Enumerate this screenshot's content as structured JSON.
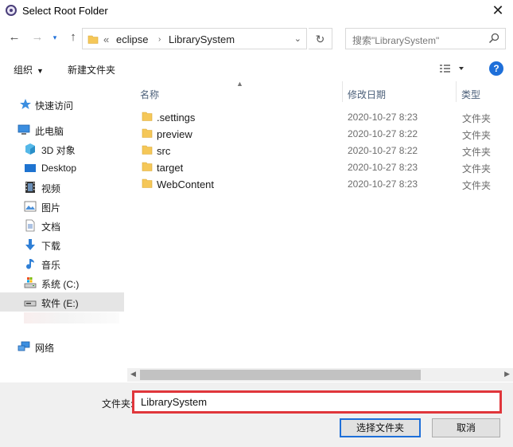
{
  "window": {
    "title": "Select Root Folder"
  },
  "nav": {
    "breadcrumb": [
      "eclipse",
      "LibrarySystem"
    ],
    "overflow": "«",
    "search_placeholder": "搜索\"LibrarySystem\""
  },
  "toolbar": {
    "organize": "组织",
    "new_folder": "新建文件夹",
    "help": "?"
  },
  "sidebar": {
    "items": [
      {
        "label": "快速访问",
        "icon": "star-icon"
      },
      {
        "label": "此电脑",
        "icon": "computer-icon"
      },
      {
        "label": "3D 对象",
        "icon": "cube-icon"
      },
      {
        "label": "Desktop",
        "icon": "desktop-icon"
      },
      {
        "label": "视频",
        "icon": "video-icon"
      },
      {
        "label": "图片",
        "icon": "pictures-icon"
      },
      {
        "label": "文档",
        "icon": "documents-icon"
      },
      {
        "label": "下载",
        "icon": "download-icon"
      },
      {
        "label": "音乐",
        "icon": "music-icon"
      },
      {
        "label": "系统 (C:)",
        "icon": "drive-icon"
      },
      {
        "label": "软件 (E:)",
        "icon": "drive-icon",
        "selected": true
      },
      {
        "label": "网络",
        "icon": "network-icon"
      }
    ]
  },
  "list": {
    "columns": {
      "name": "名称",
      "date": "修改日期",
      "type": "类型"
    },
    "rows": [
      {
        "name": ".settings",
        "date": "2020-10-27 8:23",
        "type": "文件夹"
      },
      {
        "name": "preview",
        "date": "2020-10-27 8:22",
        "type": "文件夹"
      },
      {
        "name": "src",
        "date": "2020-10-27 8:22",
        "type": "文件夹"
      },
      {
        "name": "target",
        "date": "2020-10-27 8:23",
        "type": "文件夹"
      },
      {
        "name": "WebContent",
        "date": "2020-10-27 8:23",
        "type": "文件夹"
      }
    ]
  },
  "footer": {
    "folder_label": "文件夹:",
    "folder_value": "LibrarySystem",
    "select_button": "选择文件夹",
    "cancel_button": "取消"
  },
  "colors": {
    "accent": "#1e6fd9",
    "highlight_border": "#e0363b",
    "folder": "#f5c758"
  }
}
